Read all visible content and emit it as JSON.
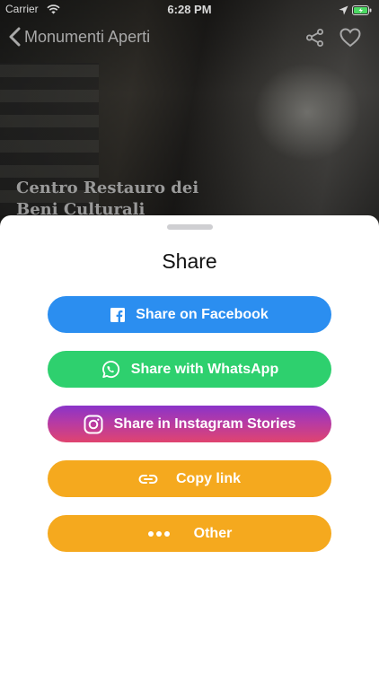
{
  "status_bar": {
    "carrier": "Carrier",
    "time": "6:28 PM"
  },
  "nav": {
    "back_label": "Monumenti Aperti"
  },
  "monument": {
    "title_line1": "Centro Restauro dei",
    "title_line2": "Beni Culturali"
  },
  "sheet": {
    "title": "Share",
    "buttons": [
      {
        "label": "Share on Facebook",
        "icon": "facebook-icon",
        "color": "#2b8ef0"
      },
      {
        "label": "Share with WhatsApp",
        "icon": "whatsapp-icon",
        "color": "#2ed06e"
      },
      {
        "label": "Share in Instagram Stories",
        "icon": "instagram-icon",
        "color": "#b53aa5"
      },
      {
        "label": "Copy link",
        "icon": "link-icon",
        "color": "#f5a91e"
      },
      {
        "label": "Other",
        "icon": "more-icon",
        "color": "#f5a91e"
      }
    ]
  }
}
